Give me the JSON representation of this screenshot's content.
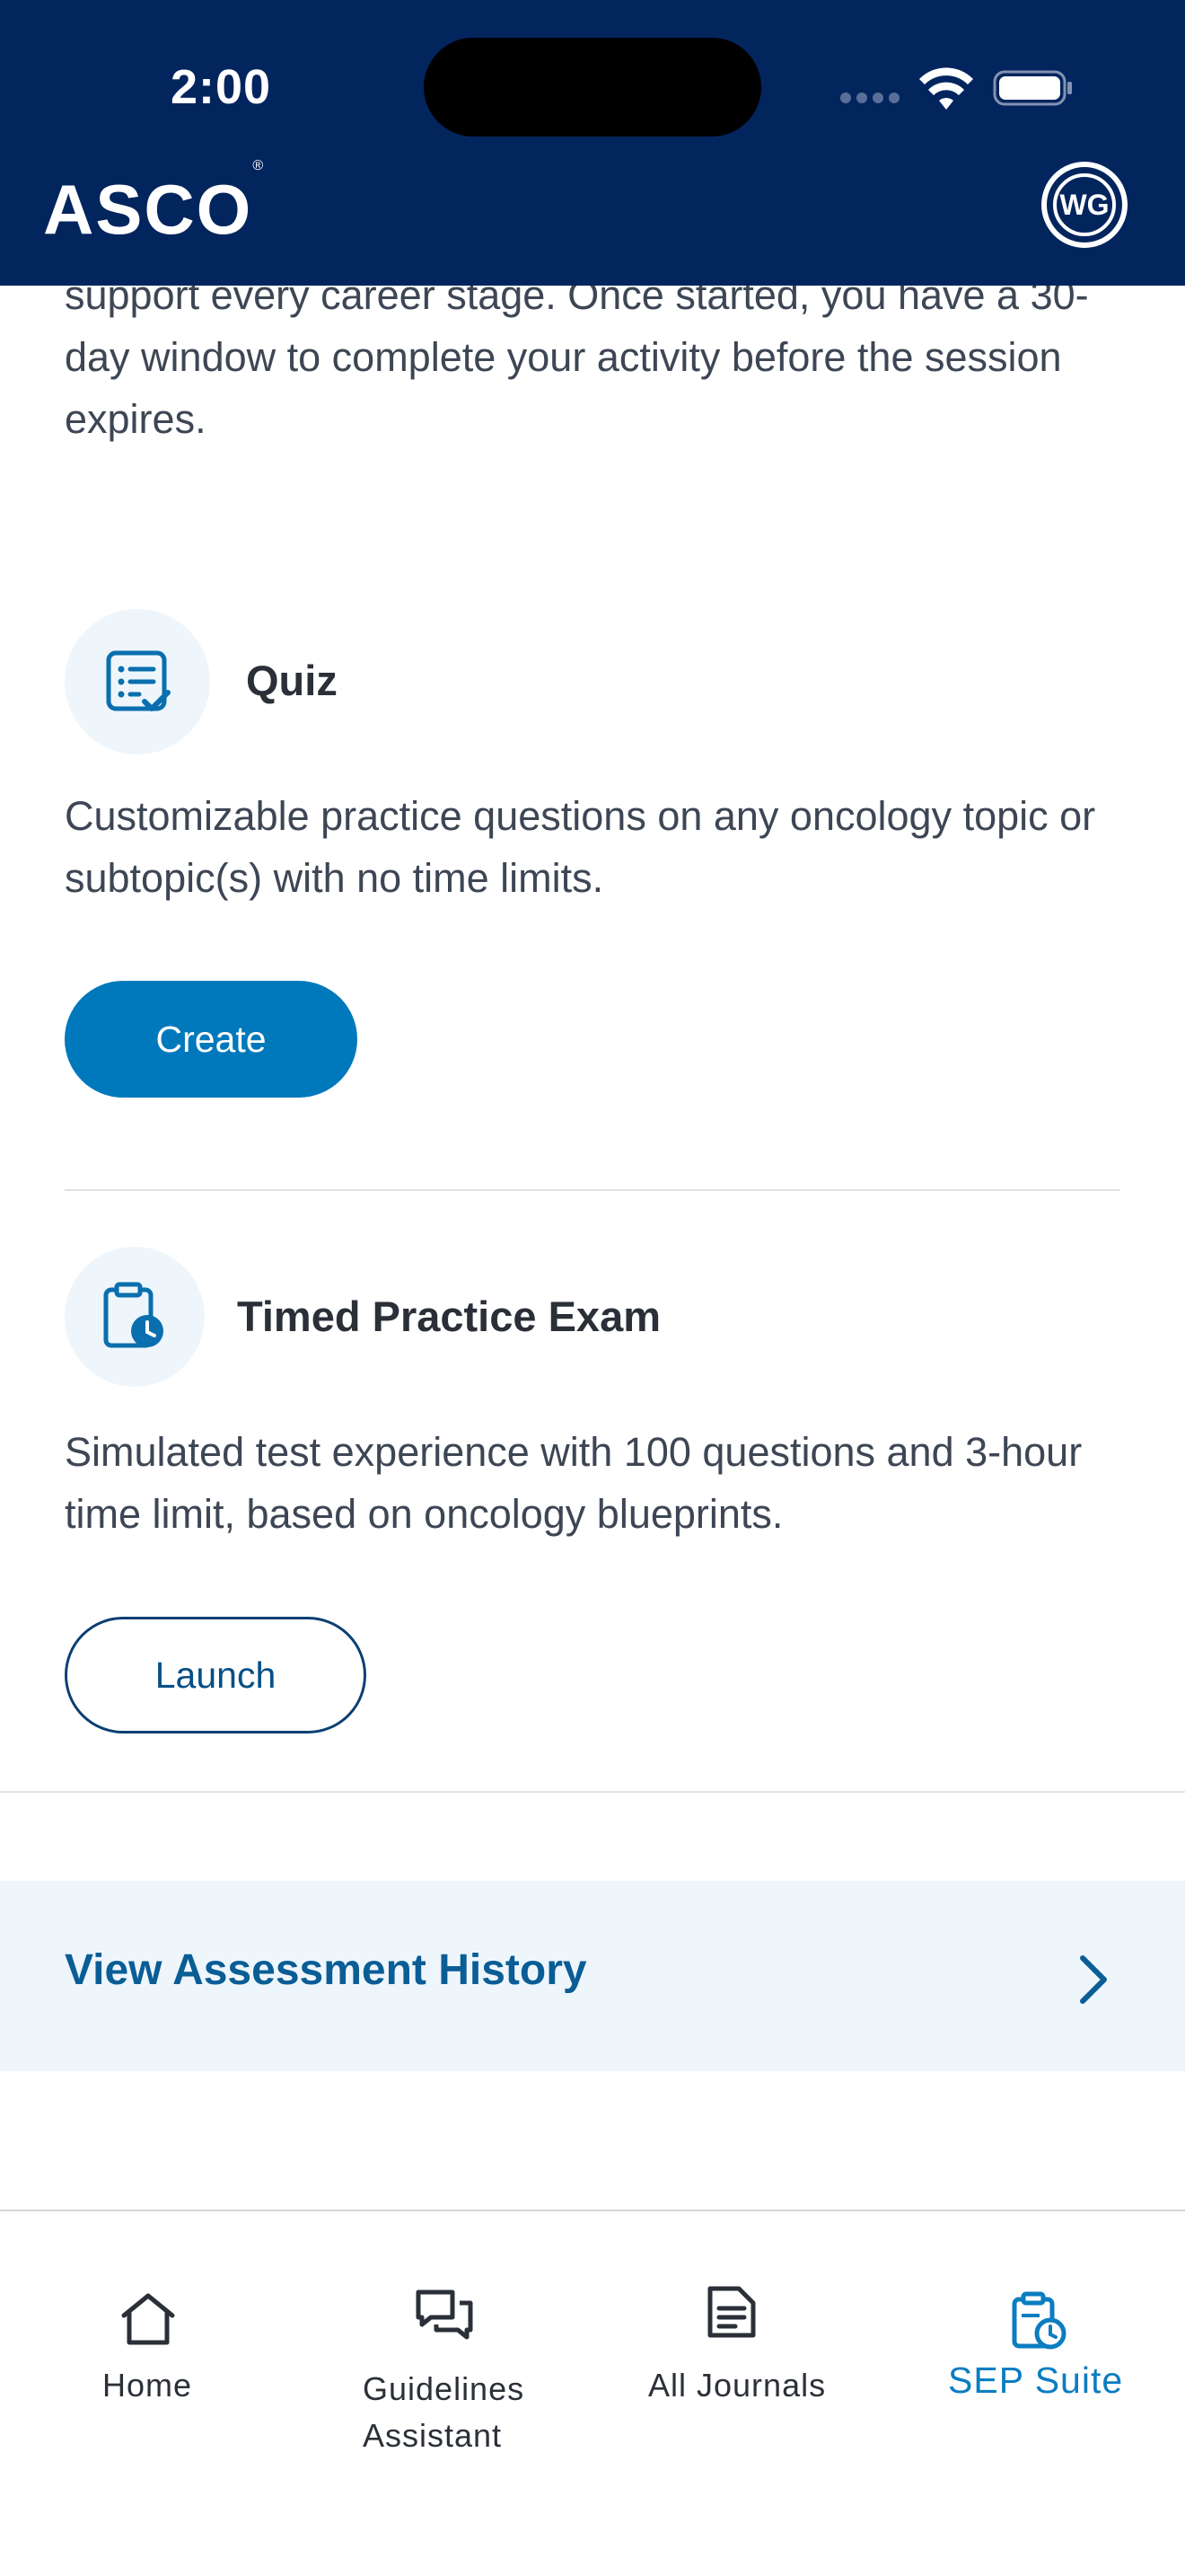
{
  "status_bar": {
    "time": "2:00"
  },
  "header": {
    "logo": "ASCO",
    "logo_mark": "®",
    "avatar_initials": "WG"
  },
  "intro": {
    "text": "support every career stage. Once started, you have a 30-day window to complete your activity before the session expires."
  },
  "quiz": {
    "title": "Quiz",
    "description": "Customizable practice questions on any oncology topic or subtopic(s) with no time limits.",
    "button_label": "Create",
    "icon": "quiz-list-check-icon"
  },
  "timed_exam": {
    "title": "Timed Practice Exam",
    "description": "Simulated test experience with 100 questions and 3-hour time limit, based on oncology blueprints.",
    "button_label": "Launch",
    "icon": "clipboard-clock-icon"
  },
  "history": {
    "label": "View Assessment History"
  },
  "bottom_nav": {
    "items": [
      {
        "label": "Home",
        "icon": "home-icon",
        "active": false
      },
      {
        "label_line1": "Guidelines",
        "label_line2": "Assistant",
        "icon": "chat-bubbles-icon",
        "active": false
      },
      {
        "label": "All Journals",
        "icon": "document-icon",
        "active": false
      },
      {
        "label": "SEP Suite",
        "icon": "clipboard-clock-icon",
        "active": true
      }
    ]
  },
  "colors": {
    "header_bg": "#03255e",
    "primary": "#0079bc",
    "active_nav": "#0b7dc1",
    "history_bg": "#eef6fc"
  }
}
